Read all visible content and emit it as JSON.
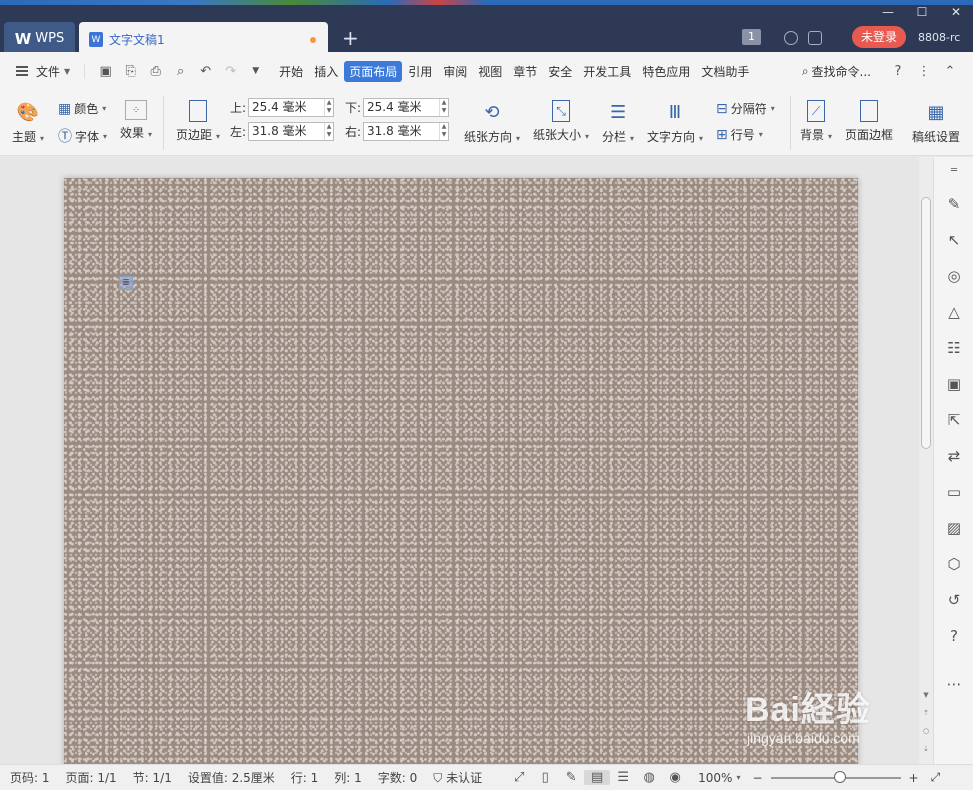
{
  "titlebar": {
    "wps_label": "WPS",
    "doc_tab": "文字文稿1",
    "new_tab": "+",
    "badge": "1",
    "login": "未登录",
    "user": "8808-rc"
  },
  "menubar": {
    "file": "文件",
    "tabs": [
      "开始",
      "插入",
      "页面布局",
      "引用",
      "审阅",
      "视图",
      "章节",
      "安全",
      "开发工具",
      "特色应用",
      "文档助手"
    ],
    "active_tab": "页面布局",
    "search": "查找命令..."
  },
  "ribbon": {
    "theme": "主题",
    "color": "颜色",
    "font": "字体",
    "effect": "效果",
    "margin": "页边距",
    "margins": {
      "top_label": "上:",
      "top": "25.4 毫米",
      "bottom_label": "下:",
      "bottom": "25.4 毫米",
      "left_label": "左:",
      "left": "31.8 毫米",
      "right_label": "右:",
      "right": "31.8 毫米"
    },
    "orientation": "纸张方向",
    "size": "纸张大小",
    "columns": "分栏",
    "text_direction": "文字方向",
    "breaks": "分隔符",
    "line_numbers": "行号",
    "background": "背景",
    "page_border": "页面边框",
    "manuscript": "稿纸设置"
  },
  "statusbar": {
    "page": "页码: 1",
    "pages": "页面: 1/1",
    "section": "节: 1/1",
    "setting": "设置值: 2.5厘米",
    "row": "行: 1",
    "col": "列: 1",
    "words": "字数: 0",
    "cert": "未认证",
    "zoom": "100%",
    "zoom_minus": "−",
    "zoom_plus": "+"
  },
  "watermark": {
    "brand": "Bai経验",
    "url": "jingyan.baidu.com"
  },
  "colors": {
    "titlebar": "#2e3a55",
    "accent": "#3b7ad8",
    "login": "#e8594f",
    "page_bg": "#9a8a80"
  }
}
